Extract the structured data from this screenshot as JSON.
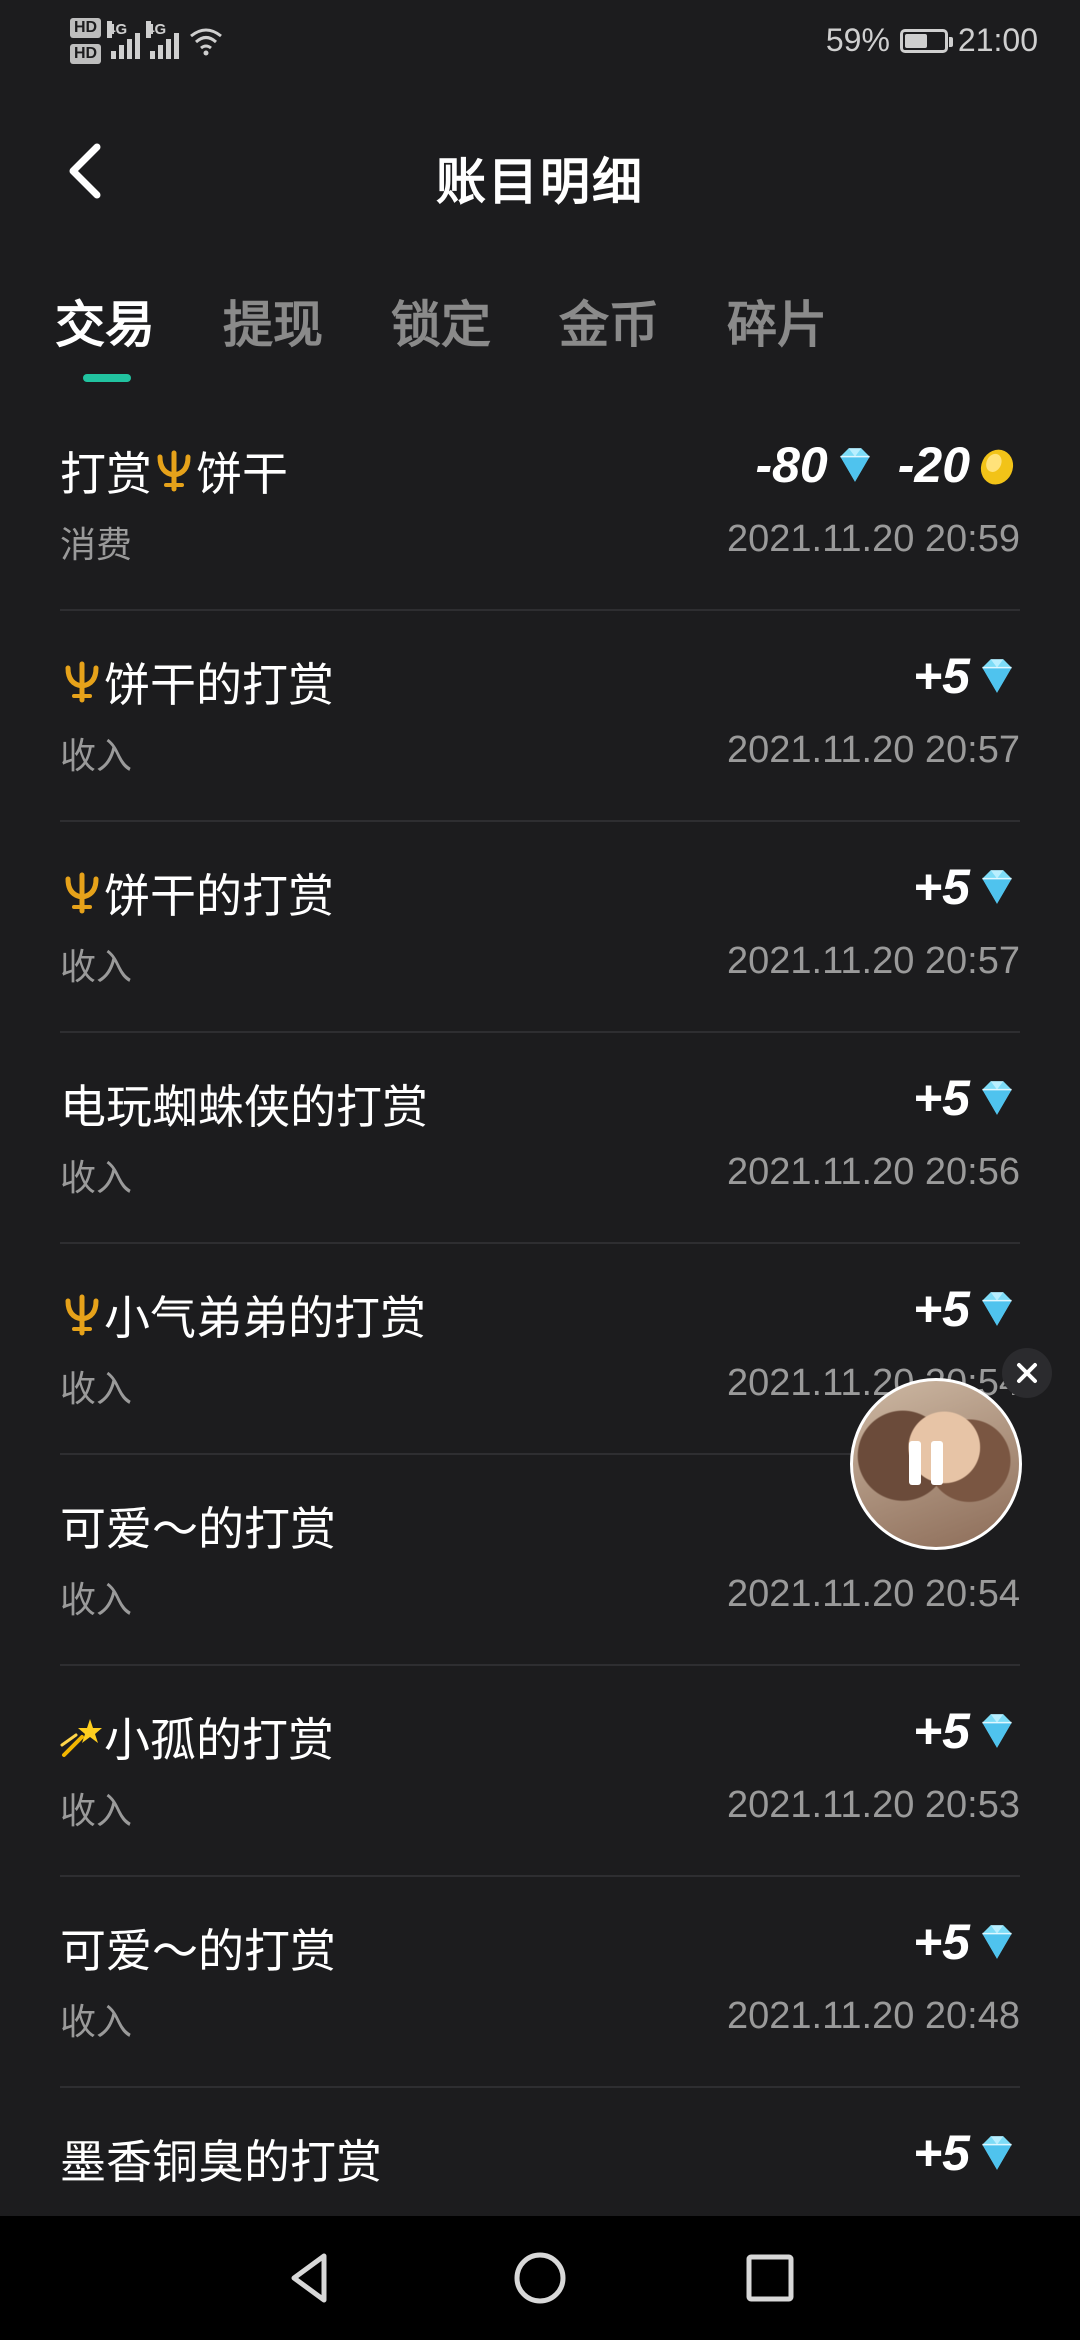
{
  "status_bar": {
    "hd1": "HD",
    "hd2": "HD",
    "net1": "4G",
    "net2": "4G",
    "battery_percent_text": "59%",
    "battery_level": 0.59,
    "time": "21:00"
  },
  "header": {
    "title": "账目明细",
    "back_icon": "chevron-left-icon"
  },
  "tabs": [
    {
      "label": "交易",
      "active": true
    },
    {
      "label": "提现",
      "active": false
    },
    {
      "label": "锁定",
      "active": false
    },
    {
      "label": "金币",
      "active": false
    },
    {
      "label": "碎片",
      "active": false
    }
  ],
  "colors": {
    "background": "#1c1c1e",
    "accent": "#21c3a0",
    "secondary_text": "#9a9a9a",
    "divider": "#2e2e31"
  },
  "transactions": [
    {
      "title_prefix": "打赏",
      "title_icon": "trident-icon",
      "title_suffix": "饼干",
      "type": "消费",
      "amount": "-80",
      "amount_icon": "diamond-icon",
      "amount2": "-20",
      "amount2_icon": "gold-coin-icon",
      "time": "2021.11.20 20:59"
    },
    {
      "title_prefix": "",
      "title_icon": "trident-icon",
      "title_suffix": "饼干的打赏",
      "type": "收入",
      "amount": "+5",
      "amount_icon": "diamond-icon",
      "time": "2021.11.20 20:57"
    },
    {
      "title_prefix": "",
      "title_icon": "trident-icon",
      "title_suffix": "饼干的打赏",
      "type": "收入",
      "amount": "+5",
      "amount_icon": "diamond-icon",
      "time": "2021.11.20 20:57"
    },
    {
      "title_prefix": "电玩蜘蛛侠的打赏",
      "title_icon": "",
      "title_suffix": "",
      "type": "收入",
      "amount": "+5",
      "amount_icon": "diamond-icon",
      "time": "2021.11.20 20:56"
    },
    {
      "title_prefix": "",
      "title_icon": "trident-icon",
      "title_suffix": "小气弟弟的打赏",
      "type": "收入",
      "amount": "+5",
      "amount_icon": "diamond-icon",
      "time": "2021.11.20 20:54"
    },
    {
      "title_prefix": "可爱～的打赏",
      "title_icon": "",
      "title_suffix": "",
      "type": "收入",
      "amount": "",
      "amount_icon": "",
      "time": "2021.11.20 20:54"
    },
    {
      "title_prefix": "",
      "title_icon": "shooting-star-icon",
      "title_suffix": "小孤的打赏",
      "type": "收入",
      "amount": "+5",
      "amount_icon": "diamond-icon",
      "time": "2021.11.20 20:53"
    },
    {
      "title_prefix": "可爱～的打赏",
      "title_icon": "",
      "title_suffix": "",
      "type": "收入",
      "amount": "+5",
      "amount_icon": "diamond-icon",
      "time": "2021.11.20 20:48"
    },
    {
      "title_prefix": "墨香铜臭的打赏",
      "title_icon": "",
      "title_suffix": "",
      "type": "",
      "amount": "+5",
      "amount_icon": "diamond-icon",
      "time": ""
    }
  ],
  "floating_player": {
    "avatar_icon": "avatar-photo",
    "state_icon": "pause-icon",
    "close_icon": "close-icon"
  },
  "nav_bar": {
    "back_icon": "triangle-back-icon",
    "home_icon": "circle-home-icon",
    "recents_icon": "square-recents-icon"
  }
}
